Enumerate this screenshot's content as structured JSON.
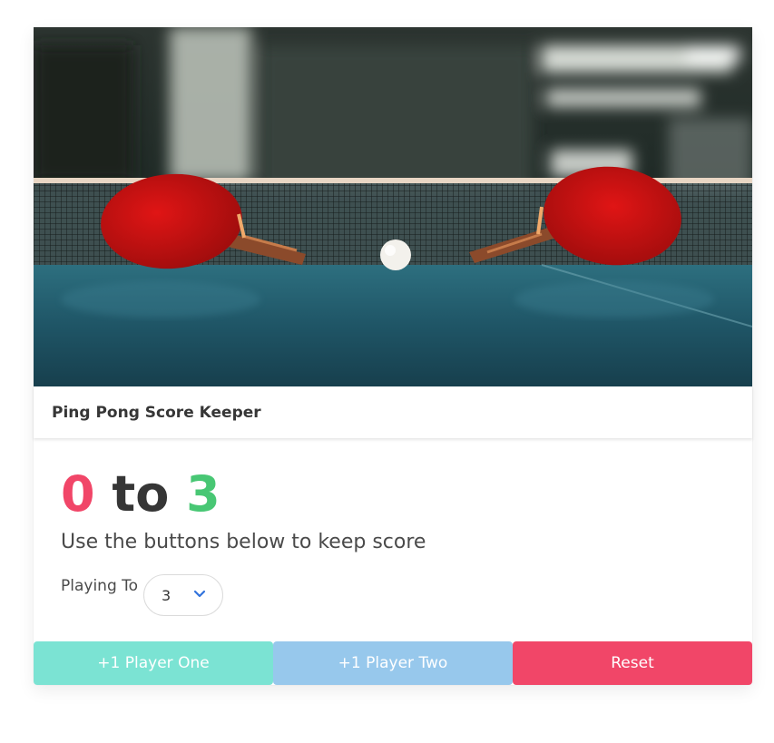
{
  "app": {
    "title": "Ping Pong Score Keeper",
    "image_alt": "table-tennis-photo"
  },
  "score": {
    "player_one": "0",
    "separator": "to",
    "player_two": "3"
  },
  "subtitle": "Use the buttons below to keep score",
  "playing_to": {
    "label": "Playing To",
    "selected": "3",
    "icon": "chevron-down-icon"
  },
  "buttons": {
    "player_one": "+1 Player One",
    "player_two": "+1 Player Two",
    "reset": "Reset"
  },
  "colors": {
    "player_one_score": "#f14668",
    "player_two_score": "#48c774",
    "player_one_button": "#7be3d3",
    "player_two_button": "#97c8ec",
    "reset_button": "#f14668",
    "chevron": "#3273dc"
  }
}
